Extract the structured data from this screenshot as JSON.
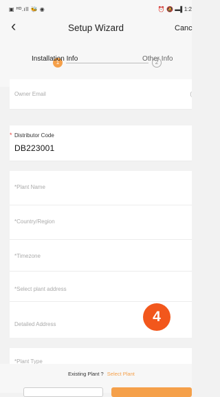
{
  "status": {
    "left_icons": "▣ ᴴᴰ.ıll 🐝 ◉",
    "right_text": "⏰ 🔕 ▬▌1:2"
  },
  "nav": {
    "title": "Setup Wizard",
    "cancel": "Canc"
  },
  "steps": [
    {
      "number": "1",
      "label": "Installation Info",
      "state": "active"
    },
    {
      "number": "2",
      "label": "Other Info",
      "state": "inactive"
    }
  ],
  "form": {
    "owner_email": {
      "label": "Owner Email",
      "right": "("
    },
    "distributor_code": {
      "required_mark": "*",
      "label": "Distributor Code",
      "value": "DB223001"
    },
    "plant_name": {
      "label": "*Plant Name"
    },
    "country_region": {
      "label": "*Country/Region"
    },
    "timezone": {
      "label": "*Timezone"
    },
    "plant_address": {
      "label": "*Select plant address"
    },
    "detailed_address": {
      "label": "Detailed Address"
    },
    "plant_type": {
      "label": "*Plant Type"
    }
  },
  "badge": "4",
  "bottom": {
    "existing_text": "Existing Plant ?",
    "select_link": "Select Plant"
  },
  "colors": {
    "accent": "#f5a04a",
    "badge": "#f2571c",
    "required": "#e8413c"
  }
}
